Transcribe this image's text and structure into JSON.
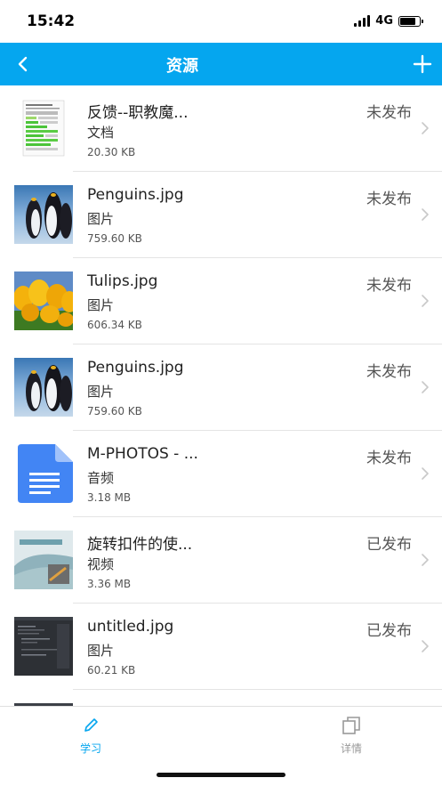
{
  "status_bar": {
    "time": "15:42",
    "network": "4G"
  },
  "nav": {
    "title": "资源"
  },
  "items": [
    {
      "name": "反馈--职教魔...",
      "type": "文档",
      "size": "20.30 KB",
      "status": "未发布",
      "thumb": "spreadsheet"
    },
    {
      "name": "Penguins.jpg",
      "type": "图片",
      "size": "759.60 KB",
      "status": "未发布",
      "thumb": "penguins"
    },
    {
      "name": "Tulips.jpg",
      "type": "图片",
      "size": "606.34 KB",
      "status": "未发布",
      "thumb": "tulips"
    },
    {
      "name": "Penguins.jpg",
      "type": "图片",
      "size": "759.60 KB",
      "status": "未发布",
      "thumb": "penguins"
    },
    {
      "name": "M-PHOTOS - ...",
      "type": "音频",
      "size": "3.18 MB",
      "status": "未发布",
      "thumb": "doc-icon"
    },
    {
      "name": "旋转扣件的使...",
      "type": "视频",
      "size": "3.36 MB",
      "status": "已发布",
      "thumb": "video"
    },
    {
      "name": "untitled.jpg",
      "type": "图片",
      "size": "60.21 KB",
      "status": "已发布",
      "thumb": "dark-screenshot"
    },
    {
      "name": "",
      "type": "",
      "size": "",
      "status": "",
      "thumb": "dark-screenshot"
    }
  ],
  "tabs": [
    {
      "label": "学习",
      "icon": "pencil-icon",
      "active": true
    },
    {
      "label": "详情",
      "icon": "copy-icon",
      "active": false
    }
  ],
  "colors": {
    "accent": "#05a6ef",
    "inactive": "#999999"
  }
}
